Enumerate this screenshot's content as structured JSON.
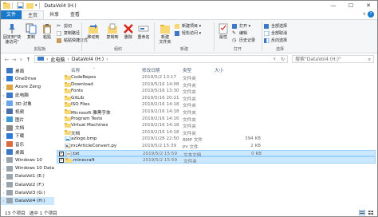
{
  "window": {
    "title": "DataVol4 (H:)",
    "controls": [
      "—",
      "☐",
      "✕"
    ],
    "help": "?",
    "collapse": "∨"
  },
  "ribbon_tabs": [
    "文件",
    "主页",
    "共享",
    "查看"
  ],
  "ribbon": {
    "clipboard": {
      "pin": "固定到\"快\n速访问\"",
      "copy": "复制",
      "paste": "粘贴",
      "cut": "剪切",
      "copy_path": "复制路径",
      "paste_shortcut": "粘贴快捷方式",
      "label": "剪贴板"
    },
    "organize": {
      "move_to": "移动到",
      "copy_to": "复制到",
      "delete": "删除",
      "rename": "重命名",
      "label": "组织"
    },
    "new": {
      "new_folder": "新建\n文件夹",
      "new_item": "新建项目 ▾",
      "easy_access": "轻松访问 ▾",
      "label": "新建"
    },
    "open": {
      "properties": "属性",
      "open": "打开 ▾",
      "edit": "编辑",
      "history": "历史记录",
      "label": "打开"
    },
    "select": {
      "select_all": "全部选择",
      "select_none": "全部取消",
      "invert": "反向选择",
      "label": "选择"
    }
  },
  "address": {
    "crumbs": [
      "此电脑",
      "DataVol4 (H:)"
    ],
    "search_placeholder": "搜索\"DataVol4 (H:)\""
  },
  "nav": [
    {
      "label": "桌面",
      "icon": "desktop-icon",
      "arrow": ""
    },
    {
      "label": "OneDrive",
      "icon": "cloud-icon",
      "arrow": "›"
    },
    {
      "label": "Azure Zeng",
      "icon": "user-icon",
      "arrow": "›"
    },
    {
      "label": "此电脑",
      "icon": "computer-icon",
      "arrow": "∨"
    },
    {
      "label": "3D 对象",
      "icon": "cube-icon",
      "arrow": "›"
    },
    {
      "label": "视频",
      "icon": "video-icon",
      "arrow": "›"
    },
    {
      "label": "图片",
      "icon": "picture-icon",
      "arrow": "›"
    },
    {
      "label": "文档",
      "icon": "document-icon",
      "arrow": "›"
    },
    {
      "label": "下载",
      "icon": "download-icon",
      "arrow": "›"
    },
    {
      "label": "音乐",
      "icon": "music-icon",
      "arrow": "›"
    },
    {
      "label": "桌面",
      "icon": "desktop-icon",
      "arrow": "›"
    },
    {
      "label": "Windows 10",
      "icon": "drive-icon",
      "arrow": "›"
    },
    {
      "label": "Windows 10 Data",
      "icon": "drive-icon",
      "arrow": "›"
    },
    {
      "label": "DataVol1 (E:)",
      "icon": "drive-icon",
      "arrow": "›"
    },
    {
      "label": "DataVol2 (F:)",
      "icon": "drive-icon",
      "arrow": "›"
    },
    {
      "label": "DataVol3 (G:)",
      "icon": "drive-icon",
      "arrow": "›"
    },
    {
      "label": "DataVol4 (H:)",
      "icon": "drive-icon",
      "arrow": "›",
      "selected": true
    }
  ],
  "columns": {
    "name": "名称",
    "date": "修改日期",
    "type": "类型",
    "size": "大小"
  },
  "files": [
    {
      "name": "CodeRepos",
      "date": "2019/5/2 13:17",
      "type": "文件夹",
      "size": "",
      "kind": "folder"
    },
    {
      "name": "Download",
      "date": "2019/5/16 14:08",
      "type": "文件夹",
      "size": "",
      "kind": "folder"
    },
    {
      "name": "Fonts",
      "date": "2019/5/16 13:30",
      "type": "文件夹",
      "size": "",
      "kind": "folder"
    },
    {
      "name": "GitLib",
      "date": "2019/5/16 20:21",
      "type": "文件夹",
      "size": "",
      "kind": "folder"
    },
    {
      "name": "ISO Files",
      "date": "2019/2/16 14:18",
      "type": "文件夹",
      "size": "",
      "kind": "folder"
    },
    {
      "name": "Microsoft 雅黑字体",
      "date": "2019/2/16 14:18",
      "type": "文件夹",
      "size": "",
      "kind": "folder"
    },
    {
      "name": "Program Tests",
      "date": "2019/2/16 14:16",
      "type": "文件夹",
      "size": "",
      "kind": "folder"
    },
    {
      "name": "Virtual Machines",
      "date": "2019/2/16 14:18",
      "type": "文件夹",
      "size": "",
      "kind": "folder"
    },
    {
      "name": "文档",
      "date": "2019/2/16 14:18",
      "type": "文件夹",
      "size": "",
      "kind": "folder"
    },
    {
      "name": "azlogo.bmp",
      "date": "2019/1/28 22:50",
      "type": "BMP 文件",
      "size": "394 KB",
      "kind": "image"
    },
    {
      "name": "mcArticleConvert.py",
      "date": "2019/5/2 15:39",
      "type": "PY 文件",
      "size": "2 KB",
      "kind": "python"
    },
    {
      "name": ".txt",
      "date": "2019/5/2 15:59",
      "type": "文本文档",
      "size": "0 KB",
      "kind": "text",
      "selected": true,
      "checked": true
    },
    {
      "name": ".minecraft",
      "date": "2019/5/2 15:59",
      "type": "文件夹",
      "size": "",
      "kind": "folder",
      "selected": true,
      "checked": true
    }
  ],
  "status": {
    "count": "13 个项目",
    "selected": "选中 1 个项目"
  },
  "colors": {
    "accent": "#1979ca",
    "selection": "#cce8ff",
    "folder": "#f8d775"
  }
}
